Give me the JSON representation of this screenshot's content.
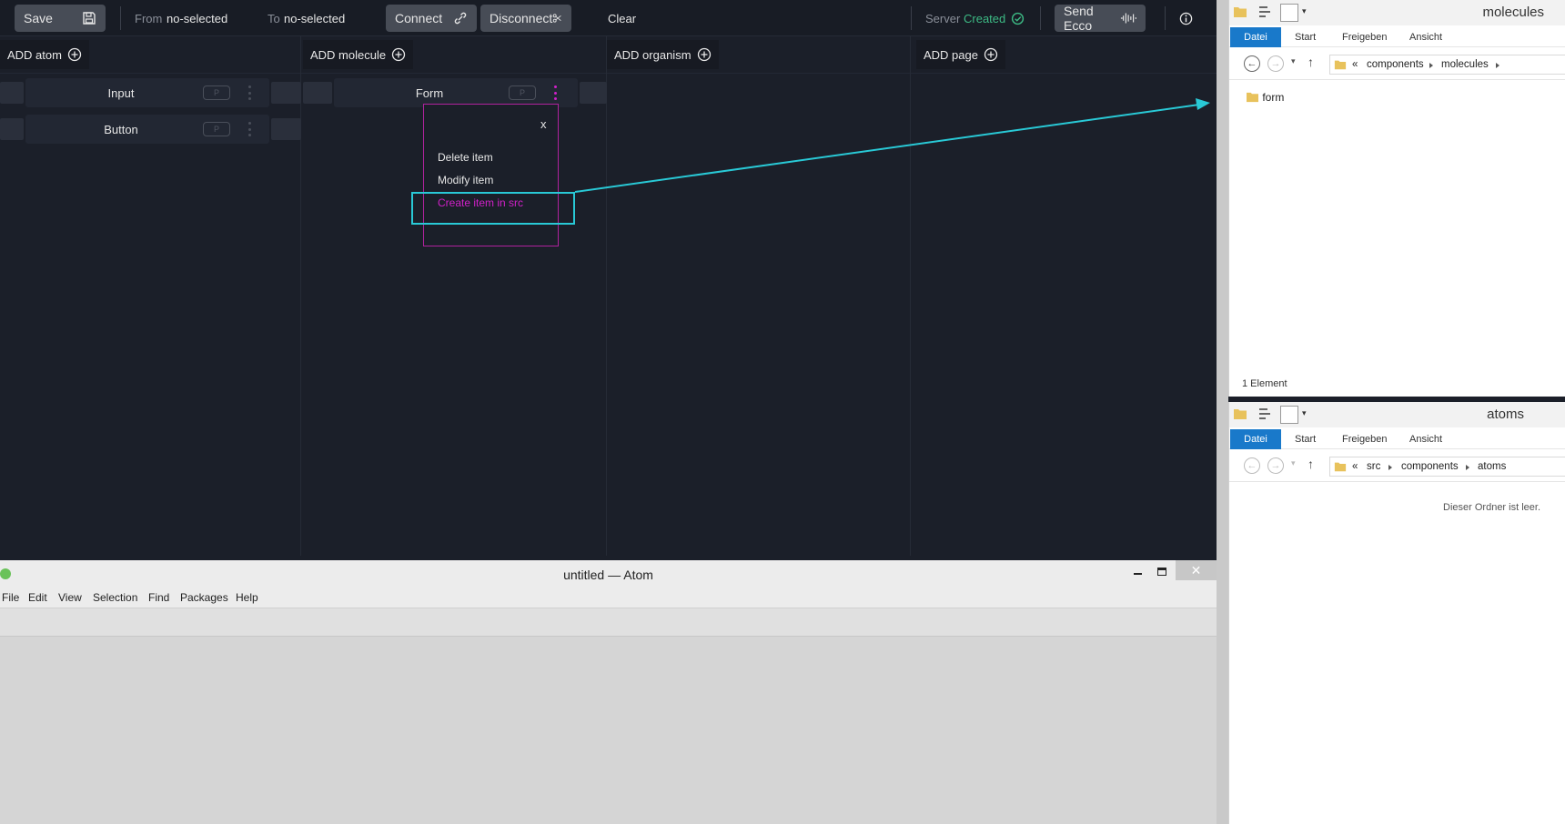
{
  "toolbar": {
    "save_label": "Save",
    "from_label": "From",
    "from_value": "no-selected",
    "to_label": "To",
    "to_value": "no-selected",
    "connect_label": "Connect",
    "disconnect_label": "Disconnect",
    "clear_label": "Clear",
    "server_label": "Server",
    "server_status": "Created",
    "send_label": "Send Ecco"
  },
  "columns": [
    {
      "label": "ADD atom"
    },
    {
      "label": "ADD molecule"
    },
    {
      "label": "ADD organism"
    },
    {
      "label": "ADD page"
    }
  ],
  "atoms": [
    {
      "label": "Input",
      "badge": "P"
    },
    {
      "label": "Button",
      "badge": "P"
    }
  ],
  "molecules": [
    {
      "label": "Form",
      "badge": "P"
    }
  ],
  "context_menu": {
    "close_label": "x",
    "delete_label": "Delete item",
    "modify_label": "Modify item",
    "create_label": "Create item in src"
  },
  "atom_editor": {
    "title": "untitled — Atom",
    "menu": [
      "File",
      "Edit",
      "View",
      "Selection",
      "Find",
      "Packages",
      "Help"
    ]
  },
  "explorer_top": {
    "title": "molecules",
    "ribbon": [
      "Datei",
      "Start",
      "Freigeben",
      "Ansicht"
    ],
    "path": [
      "«",
      "components",
      "molecules"
    ],
    "items": [
      "form"
    ],
    "status": "1 Element"
  },
  "explorer_bottom": {
    "title": "atoms",
    "ribbon": [
      "Datei",
      "Start",
      "Freigeben",
      "Ansicht"
    ],
    "path": [
      "«",
      "src",
      "components",
      "atoms"
    ],
    "empty_text": "Dieser Ordner ist leer."
  },
  "colors": {
    "accent_pink": "#d020c8",
    "highlight_cyan": "#29c9d6",
    "server_green": "#3dbb85",
    "explorer_blue": "#1979ca"
  }
}
